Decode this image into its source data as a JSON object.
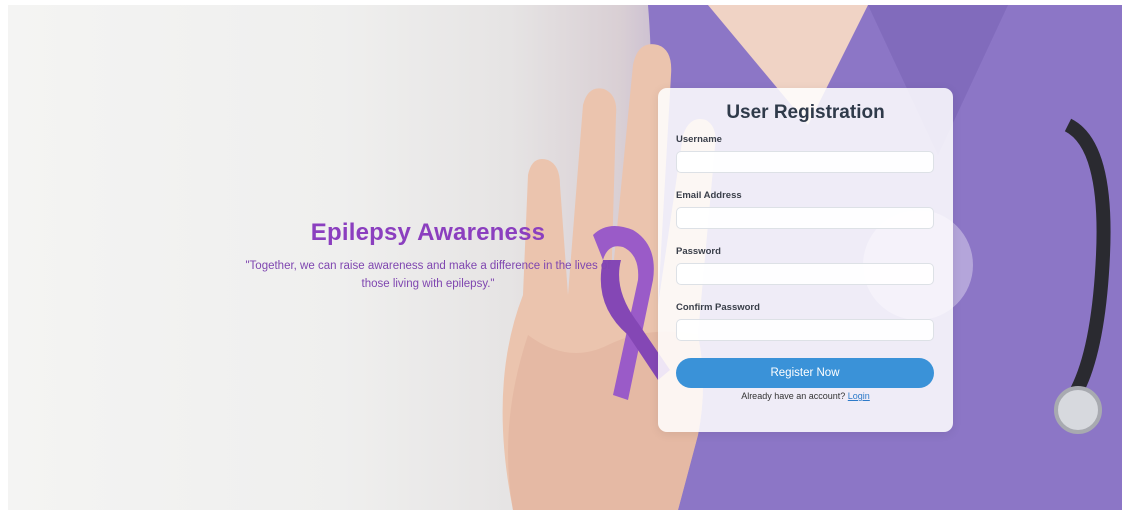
{
  "hero": {
    "title": "Epilepsy Awareness",
    "quote_line1": "\"Together, we can raise awareness and make a difference in the lives of",
    "quote_line2": "those living with epilepsy.\""
  },
  "form": {
    "title": "User Registration",
    "fields": [
      {
        "label": "Username",
        "value": "",
        "type": "text"
      },
      {
        "label": "Email Address",
        "value": "",
        "type": "email"
      },
      {
        "label": "Password",
        "value": "",
        "type": "password"
      },
      {
        "label": "Confirm Password",
        "value": "",
        "type": "password"
      }
    ],
    "submit_label": "Register Now",
    "login_prompt": "Already have an account?",
    "login_link": "Login"
  },
  "colors": {
    "accent_purple": "#8b3fbf",
    "button_blue": "#3a92d8",
    "link_blue": "#2d7ac9",
    "scrubs_purple": "#8a73c4"
  }
}
